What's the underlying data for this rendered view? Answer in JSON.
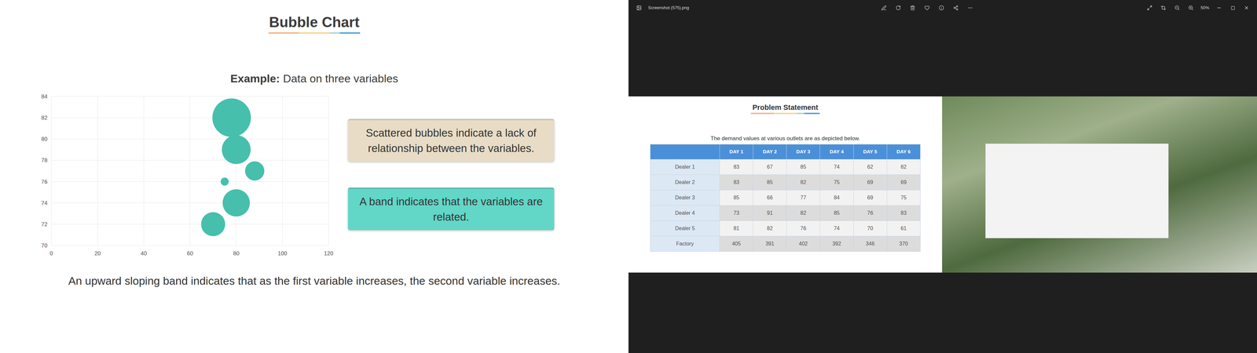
{
  "slide": {
    "title": "Bubble Chart",
    "example_label": "Example:",
    "example_text": "Data on three variables",
    "footer": "An upward sloping band indicates that as the first variable increases, the second variable increases."
  },
  "chart": {
    "y_ticks": [
      "84",
      "82",
      "80",
      "78",
      "76",
      "74",
      "72",
      "70"
    ],
    "x_ticks": [
      "0",
      "20",
      "40",
      "60",
      "80",
      "100",
      "120"
    ],
    "series": [
      {
        "name": "bubbles",
        "x": [
          78,
          80,
          88,
          75,
          80,
          70
        ],
        "y": [
          82,
          79,
          77,
          76,
          74,
          72
        ],
        "size": [
          24,
          18,
          12,
          5,
          17,
          15
        ],
        "color": "#46bfad"
      }
    ]
  },
  "callouts": [
    {
      "text": "Scattered bubbles indicate a lack of relationship between the variables.",
      "color": "#e8dcc6"
    },
    {
      "text": "A band indicates that the variables are related.",
      "color": "#62d6c7"
    }
  ],
  "viewer": {
    "title": "Screenshot (575).png",
    "zoom": "50%"
  },
  "image": {
    "title": "Problem Statement",
    "caption": "The demand values at various outlets are as depicted below.",
    "columns": [
      "DAY 1",
      "DAY 2",
      "DAY 3",
      "DAY 4",
      "DAY 5",
      "DAY 6"
    ],
    "rows": [
      {
        "label": "Dealer 1",
        "values": [
          "83",
          "67",
          "85",
          "74",
          "62",
          "82"
        ]
      },
      {
        "label": "Dealer 2",
        "values": [
          "83",
          "85",
          "82",
          "75",
          "69",
          "69"
        ]
      },
      {
        "label": "Dealer 3",
        "values": [
          "85",
          "66",
          "77",
          "84",
          "69",
          "75"
        ]
      },
      {
        "label": "Dealer 4",
        "values": [
          "73",
          "91",
          "82",
          "85",
          "76",
          "83"
        ]
      },
      {
        "label": "Dealer 5",
        "values": [
          "81",
          "82",
          "76",
          "74",
          "70",
          "61"
        ]
      }
    ],
    "total": {
      "label": "Factory",
      "values": [
        "405",
        "391",
        "402",
        "392",
        "346",
        "370"
      ]
    }
  }
}
